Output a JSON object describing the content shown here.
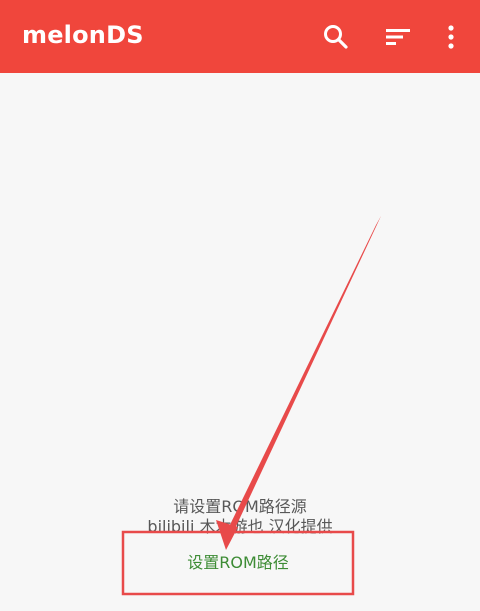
{
  "app": {
    "title": "melonDS"
  },
  "toolbar": {
    "icons": [
      "search-icon",
      "sort-icon",
      "more-vert-icon"
    ]
  },
  "empty_state": {
    "message": "请设置ROM路径源",
    "credit": "bilibili 木木游也 汉化提供"
  },
  "actions": {
    "set_rom_path_label": "设置ROM路径"
  },
  "colors": {
    "appbar": "#f0463c",
    "button_text": "#3d8c35",
    "annotation": "#e84a4a"
  }
}
